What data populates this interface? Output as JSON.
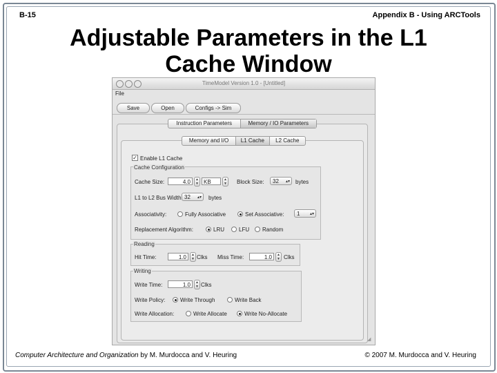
{
  "slide": {
    "number": "B-15",
    "header": "Appendix B - Using ARCTools",
    "title_line1": "Adjustable Parameters in the L1",
    "title_line2": "Cache Window",
    "footer_left_italic": "Computer Architecture and Organization",
    "footer_left_rest": " by M. Murdocca and V. Heuring",
    "footer_right": "© 2007 M. Murdocca and V. Heuring"
  },
  "window": {
    "title": "TimeModel Version 1.0 - [Untitled]",
    "menu": "File",
    "buttons": {
      "save": "Save",
      "open": "Open",
      "configs": "Configs -> Sim"
    },
    "top_tabs": [
      "Instruction Parameters",
      "Memory / IO Parameters"
    ],
    "sub_tabs": [
      "Memory and I/O",
      "L1 Cache",
      "L2 Cache"
    ],
    "enable_l1": {
      "label": "Enable L1 Cache",
      "checked": true
    },
    "cache_config": {
      "title": "Cache Configuration",
      "cache_size_label": "Cache Size:",
      "cache_size_value": "4.0",
      "cache_size_unit": "KB",
      "block_size_label": "Block Size:",
      "block_size_value": "32",
      "block_size_unit": "bytes",
      "bus_width_label": "L1 to L2 Bus Width:",
      "bus_width_value": "32",
      "bus_width_unit": "bytes",
      "assoc_label": "Associativity:",
      "assoc_full": "Fully Associative",
      "assoc_set": "Set Associative:",
      "assoc_set_value": "1",
      "assoc_selected": "set",
      "repl_label": "Replacement Algorithm:",
      "repl_lru": "LRU",
      "repl_lfu": "LFU",
      "repl_random": "Random",
      "repl_selected": "lru"
    },
    "reading": {
      "title": "Reading",
      "hit_label": "Hit Time:",
      "hit_value": "1.0",
      "hit_unit": "Clks",
      "miss_label": "Miss Time:",
      "miss_value": "1.0",
      "miss_unit": "Clks"
    },
    "writing": {
      "title": "Writing",
      "write_time_label": "Write Time:",
      "write_time_value": "1.0",
      "write_time_unit": "Clks",
      "policy_label": "Write Policy:",
      "policy_through": "Write Through",
      "policy_back": "Write Back",
      "policy_selected": "through",
      "alloc_label": "Write Allocation:",
      "alloc_allocate": "Write Allocate",
      "alloc_no": "Write No-Allocate",
      "alloc_selected": "no"
    }
  }
}
